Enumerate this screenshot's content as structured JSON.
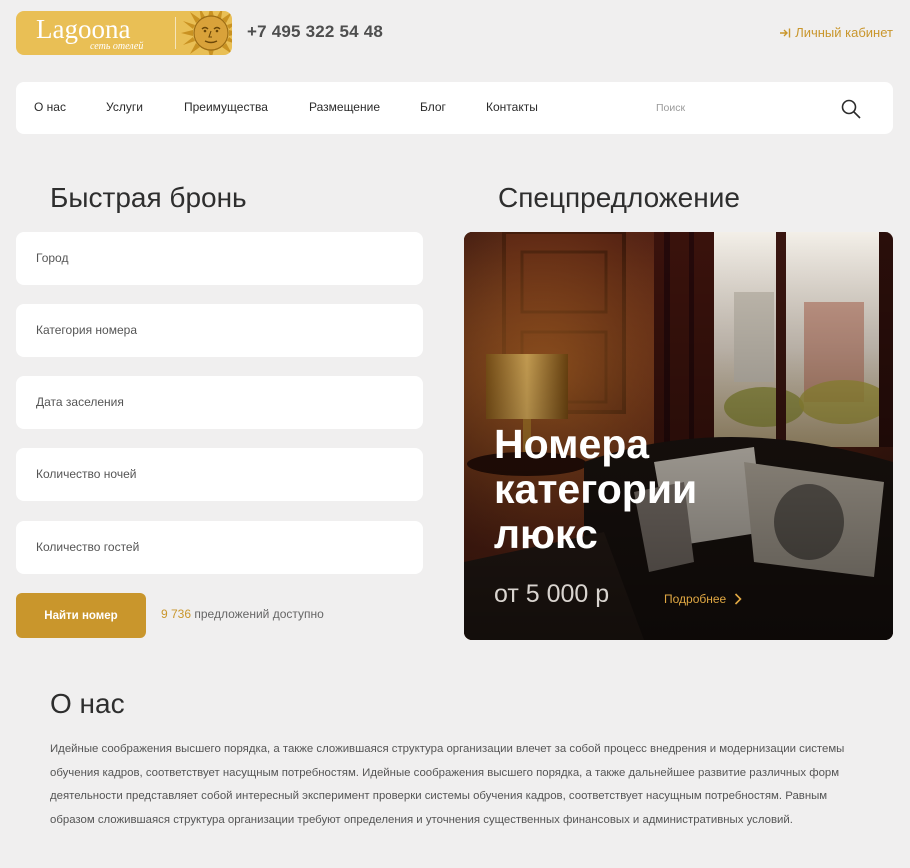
{
  "header": {
    "logo_text": "Lagoona",
    "logo_subtitle": "сеть отелей",
    "phone": "+7 495 322 54 48",
    "cabinet_label": "Личный кабинет",
    "accent_color": "#c9962c"
  },
  "nav": {
    "items": [
      {
        "label": "О нас"
      },
      {
        "label": "Услуги"
      },
      {
        "label": "Преимущества"
      },
      {
        "label": "Размещение"
      },
      {
        "label": "Блог"
      },
      {
        "label": "Контакты"
      }
    ],
    "search_placeholder": "Поиск",
    "search_icon": "search-icon"
  },
  "booking": {
    "title": "Быстрая бронь",
    "fields": [
      {
        "label": "Город"
      },
      {
        "label": "Категория номера"
      },
      {
        "label": "Дата заселения"
      },
      {
        "label": "Количество ночей"
      },
      {
        "label": "Количество гостей"
      }
    ],
    "submit_label": "Найти номер",
    "offers_count": "9 736",
    "offers_suffix": "предложений доступно"
  },
  "special": {
    "title": "Спецпредложение",
    "card_title": "Номера категории люкс",
    "price": "от 5 000 р",
    "more_label": "Подробнее"
  },
  "about": {
    "title": "О нас",
    "text": "Идейные соображения высшего порядка, а также сложившаяся структура организации влечет за собой процесс внедрения и модернизации системы обучения кадров, соответствует насущным потребностям. Идейные соображения высшего порядка, а также дальнейшее развитие различных форм деятельности представляет собой интересный эксперимент проверки системы обучения кадров, соответствует насущным потребностям. Равным образом сложившаяся структура организации требуют определения и уточнения существенных финансовых и административных условий."
  }
}
